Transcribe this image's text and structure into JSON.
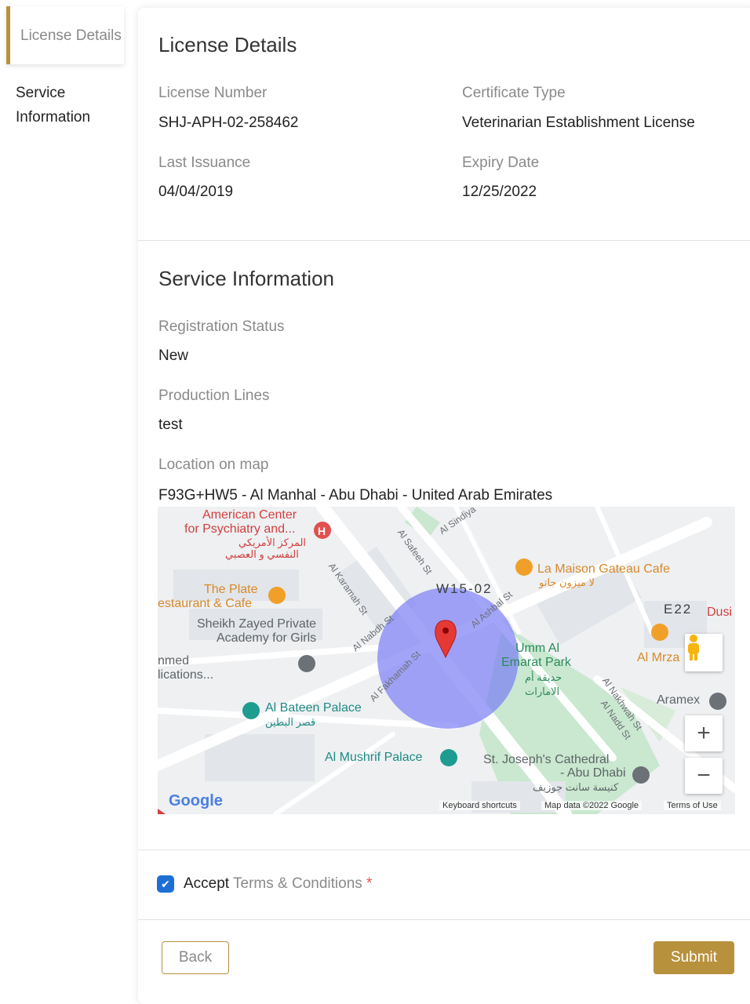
{
  "sidebar": {
    "items": [
      {
        "label": "License Details"
      },
      {
        "label": "Service Information"
      }
    ]
  },
  "license": {
    "title": "License Details",
    "license_number_label": "License Number",
    "license_number": "SHJ-APH-02-258462",
    "certificate_type_label": "Certificate Type",
    "certificate_type": "Veterinarian Establishment License",
    "last_issuance_label": "Last Issuance",
    "last_issuance": "04/04/2019",
    "expiry_date_label": "Expiry Date",
    "expiry_date": "12/25/2022"
  },
  "service": {
    "title": "Service Information",
    "registration_status_label": "Registration Status",
    "registration_status": "New",
    "production_lines_label": "Production Lines",
    "production_lines": "test",
    "location_label": "Location on map",
    "location": "F93G+HW5 - Al Manhal - Abu Dhabi - United Arab Emirates"
  },
  "map": {
    "places": {
      "american_center_1": "American Center",
      "american_center_2": "for Psychiatry and...",
      "american_center_ar1": "المركز الأمريكي",
      "american_center_ar2": "النفسي و العصبي",
      "plate_cafe_1": "The Plate",
      "plate_cafe_2": "estaurant & Cafe",
      "sheikh_zayed_1": "Sheikh Zayed Private",
      "sheikh_zayed_2": "Academy for Girls",
      "nmed_1": "nmed",
      "nmed_2": "lications...",
      "la_maison": "La Maison Gateau Cafe",
      "la_maison_ar": "لا ميزون جاتو",
      "w15": "W15-02",
      "e22": "E22",
      "dusi": "Dusi",
      "umm_al_1": "Umm Al",
      "umm_al_2": "Emarat Park",
      "umm_al_ar": "حديقة أم الامارات",
      "al_mrza": "Al Mrza",
      "aramex": "Aramex",
      "al_bateen": "Al Bateen Palace",
      "al_bateen_ar": "قصر البطين",
      "al_mushrif": "Al Mushrif Palace",
      "st_joseph_1": "St. Joseph's Cathedral",
      "st_joseph_2": "- Abu Dhabi",
      "st_joseph_ar": "كنيسة سانت جوزيف",
      "google": "Google"
    },
    "streets": {
      "karamah": "Al Karamah St",
      "safeeh": "Al Safeeh St",
      "sindiya": "Al Sindiya",
      "ashbal": "Al Ashbal St",
      "nabdh": "Al Nabdh St",
      "fakhamah": "Al Fakhamah St",
      "nakhwah": "Al Nakhwah St",
      "nadd": "Al Nadd St"
    },
    "zoom_in": "+",
    "zoom_out": "−",
    "keyboard_shortcuts": "Keyboard shortcuts",
    "map_data": "Map data ©2022 Google",
    "terms_of_use": "Terms of Use",
    "pegman_icon": "pegman-icon",
    "pin_icon": "map-pin-icon"
  },
  "terms": {
    "accept": "Accept",
    "link": "Terms & Conditions",
    "required": "*"
  },
  "buttons": {
    "back": "Back",
    "submit": "Submit"
  },
  "colors": {
    "accent": "#b8913d",
    "checkbox": "#1d6fd6",
    "radius_fill": "#7b7ef5"
  }
}
